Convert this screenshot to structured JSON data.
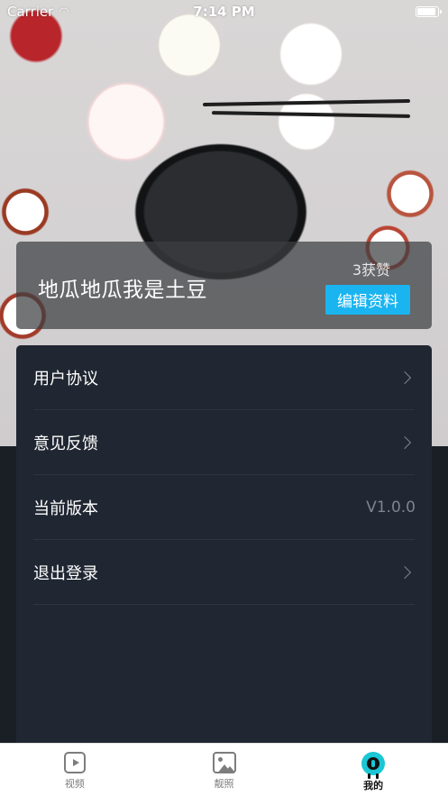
{
  "status_bar": {
    "carrier": "Carrier",
    "time": "7:14 PM"
  },
  "profile": {
    "name": "地瓜地瓜我是土豆",
    "likes": "3获赞",
    "edit_label": "编辑资料"
  },
  "menu": {
    "items": [
      {
        "label": "用户协议"
      },
      {
        "label": "意见反馈"
      },
      {
        "label": "当前版本",
        "value": "V1.0.0"
      },
      {
        "label": "退出登录"
      }
    ]
  },
  "tab_bar": {
    "tabs": [
      {
        "label": "视频",
        "icon": "video-icon"
      },
      {
        "label": "靓照",
        "icon": "photo-icon"
      },
      {
        "label": "我的",
        "icon": "profile-icon",
        "active": true
      }
    ]
  },
  "colors": {
    "accent": "#1ab4f0",
    "panel": "#202732",
    "tab_active": "#19c7d5"
  }
}
